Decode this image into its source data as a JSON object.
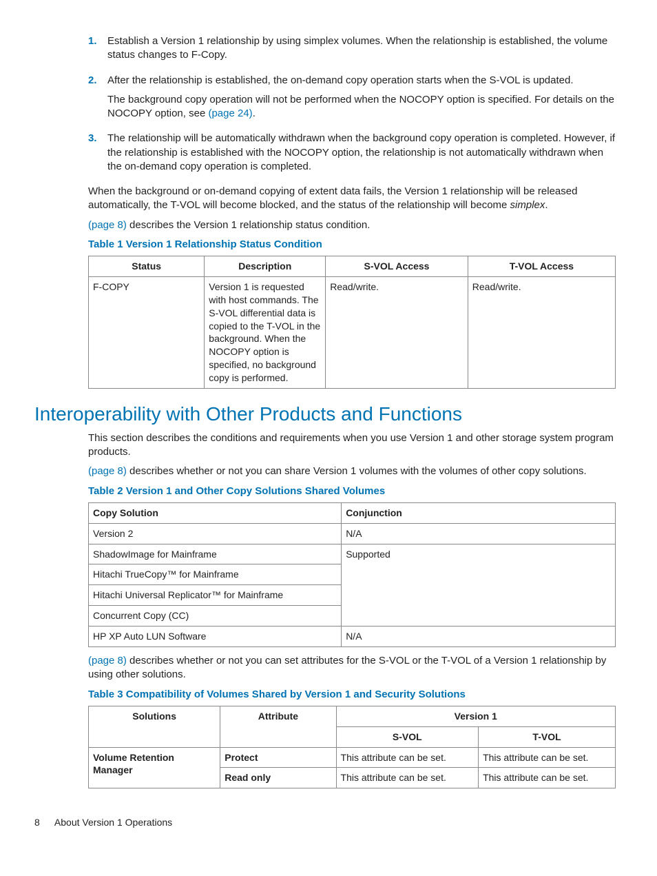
{
  "list": {
    "item1": {
      "num": "1.",
      "text": "Establish a Version 1 relationship by using simplex volumes. When the relationship is established, the volume status changes to F-Copy."
    },
    "item2": {
      "num": "2.",
      "p1": "After the relationship is established, the on-demand copy operation starts when the S-VOL is updated.",
      "p2a": "The background copy operation will not be performed when the NOCOPY option is specified. For details on the NOCOPY option, see ",
      "p2link": "(page 24)",
      "p2b": "."
    },
    "item3": {
      "num": "3.",
      "text": "The relationship will be automatically withdrawn when the background copy operation is completed. However, if the relationship is established with the NOCOPY option, the relationship is not automatically withdrawn when the on-demand copy operation is completed."
    }
  },
  "para1a": "When the background or on-demand copying of extent data fails, the Version 1 relationship will be released automatically, the T-VOL will become blocked, and the status of the relationship will become ",
  "para1italic": "simplex",
  "para1b": ".",
  "para2link": "(page 8)",
  "para2": " describes the Version 1 relationship status condition.",
  "table1": {
    "title": "Table 1 Version 1 Relationship Status Condition",
    "h1": "Status",
    "h2": "Description",
    "h3": "S-VOL Access",
    "h4": "T-VOL Access",
    "r1c1": "F-COPY",
    "r1c2": "Version 1 is requested with host commands. The S-VOL differential data is copied to the T-VOL in the background. When the NOCOPY option is specified, no background copy is performed.",
    "r1c3": "Read/write.",
    "r1c4": "Read/write."
  },
  "section": "Interoperability with Other Products and Functions",
  "para3": "This section describes the conditions and requirements when you use Version 1 and other storage system program products.",
  "para4link": "(page 8)",
  "para4": " describes whether or not you can share Version 1 volumes with the volumes of other copy solutions.",
  "table2": {
    "title": "Table 2 Version 1 and Other Copy Solutions Shared Volumes",
    "h1": "Copy Solution",
    "h2": "Conjunction",
    "r1c1": "Version 2",
    "r1c2": "N/A",
    "r2c1": "ShadowImage for Mainframe",
    "r2c2": "Supported",
    "r3c1": "Hitachi TrueCopy™ for Mainframe",
    "r4c1": "Hitachi Universal Replicator™ for Mainframe",
    "r5c1": "Concurrent Copy (CC)",
    "r6c1": "HP XP Auto LUN Software",
    "r6c2": "N/A"
  },
  "para5link": "(page 8)",
  "para5": " describes whether or not you can set attributes for the S-VOL or the T-VOL of a Version 1 relationship by using other solutions.",
  "table3": {
    "title": "Table 3 Compatibility of Volumes Shared by Version 1 and Security Solutions",
    "h1": "Solutions",
    "h2": "Attribute",
    "h3": "Version 1",
    "sh1": "S-VOL",
    "sh2": "T-VOL",
    "r1c1": "Volume Retention Manager",
    "r1c2": "Protect",
    "r1c3": "This attribute can be set.",
    "r1c4": "This attribute can be set.",
    "r2c2": "Read only",
    "r2c3": "This attribute can be set.",
    "r2c4": "This attribute can be set."
  },
  "footer": {
    "page": "8",
    "title": "About Version 1 Operations"
  }
}
